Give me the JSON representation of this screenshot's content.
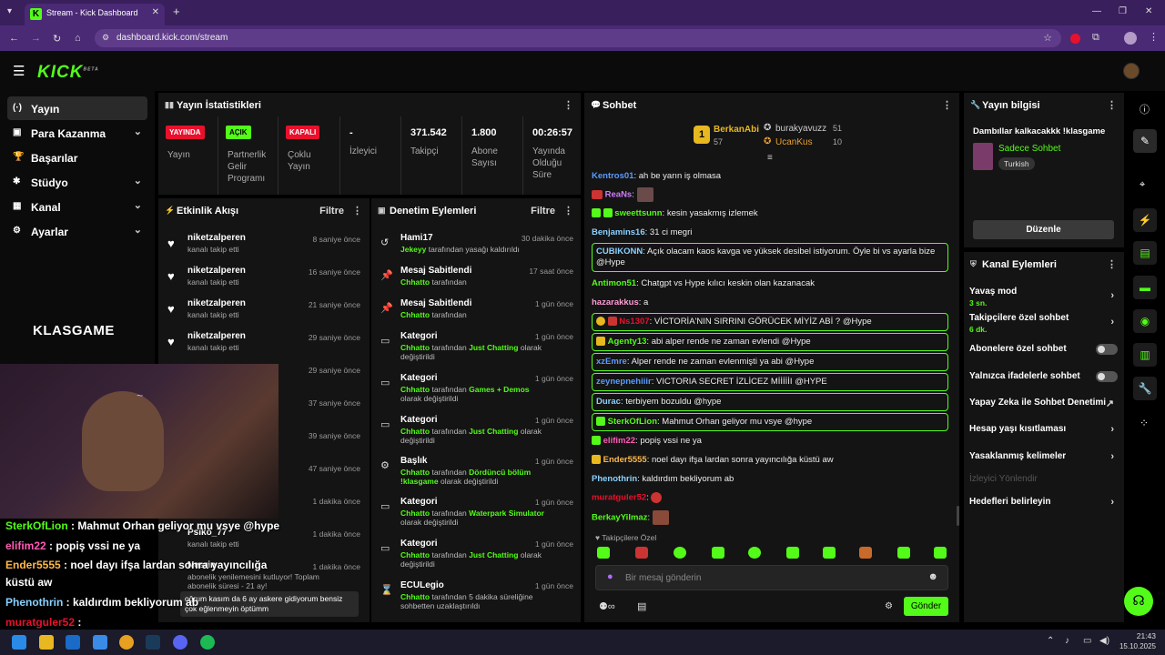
{
  "browser": {
    "tab_title": "Stream - Kick Dashboard",
    "url": "dashboard.kick.com/stream",
    "favicon_letter": "K"
  },
  "app": {
    "logo": "KICK",
    "logo_sup": "BETA"
  },
  "sidebar": {
    "items": [
      {
        "label": "Yayın",
        "icon": "broadcast-icon"
      },
      {
        "label": "Para Kazanma",
        "icon": "money-icon"
      },
      {
        "label": "Başarılar",
        "icon": "trophy-icon"
      },
      {
        "label": "Stüdyo",
        "icon": "studio-icon"
      },
      {
        "label": "Kanal",
        "icon": "channel-icon"
      },
      {
        "label": "Ayarlar",
        "icon": "gear-icon"
      }
    ],
    "brand": "KLASGAME"
  },
  "stats": {
    "title": "Yayın İstatistikleri",
    "items": [
      {
        "value": "YAYINDA",
        "label": "Yayın",
        "color": "#e8112d"
      },
      {
        "value": "AÇIK",
        "label": "Partnerlik Gelir Programı",
        "color": "#53fc18"
      },
      {
        "value": "KAPALI",
        "label": "Çoklu Yayın",
        "color": "#e8112d"
      },
      {
        "value": "-",
        "label": "İzleyici"
      },
      {
        "value": "371.542",
        "label": "Takipçi"
      },
      {
        "value": "1.800",
        "label": "Abone Sayısı"
      },
      {
        "value": "00:26:57",
        "label": "Yayında Olduğu Süre"
      }
    ]
  },
  "activity": {
    "title": "Etkinlik Akışı",
    "filter": "Filtre",
    "items": [
      {
        "name": "niketzalperen",
        "sub": "kanalı takip etti",
        "time": "8 saniye önce"
      },
      {
        "name": "niketzalperen",
        "sub": "kanalı takip etti",
        "time": "16 saniye önce"
      },
      {
        "name": "niketzalperen",
        "sub": "kanalı takip etti",
        "time": "21 saniye önce"
      },
      {
        "name": "niketzalperen",
        "sub": "kanalı takip etti",
        "time": "29 saniye önce"
      },
      {
        "time": "29 saniye önce"
      },
      {
        "time": "37 saniye önce"
      },
      {
        "time": "39 saniye önce"
      },
      {
        "time": "47 saniye önce"
      },
      {
        "time": "1 dakika önce"
      },
      {
        "name": "Psiko_77",
        "sub": "kanalı takip etti",
        "time": "1 dakika önce"
      },
      {
        "name": "Nesrin",
        "sub": "abonelik yenilemesini kutluyor! Toplam abonelik süresi - 21 ay!",
        "time": "1 dakika önce"
      }
    ],
    "bubble": "oğrum kasım da 6 ay askere gidiyorum bensiz çok eğlenmeyin öptümm"
  },
  "moderation": {
    "title": "Denetim Eylemleri",
    "filter": "Filtre",
    "items": [
      {
        "title": "Hami17",
        "by": "Jekeyy",
        "rest": "tarafından yasağı kaldırıldı",
        "time": "30 dakika önce",
        "icon": "undo-icon"
      },
      {
        "title": "Mesaj Sabitlendi",
        "by": "Chhatto",
        "rest": "tarafından",
        "time": "17 saat önce",
        "icon": "pin-icon"
      },
      {
        "title": "Mesaj Sabitlendi",
        "by": "Chhatto",
        "rest": "tarafından",
        "time": "1 gün önce",
        "icon": "pin-icon"
      },
      {
        "title": "Kategori",
        "by": "Chhatto",
        "rest": "tarafından",
        "cat": "Just Chatting",
        "rest2": "olarak değiştirildi",
        "time": "1 gün önce",
        "icon": "category-icon"
      },
      {
        "title": "Kategori",
        "by": "Chhatto",
        "rest": "tarafından",
        "cat": "Games + Demos",
        "rest2": "olarak değiştirildi",
        "time": "1 gün önce",
        "icon": "category-icon"
      },
      {
        "title": "Kategori",
        "by": "Chhatto",
        "rest": "tarafından",
        "cat": "Just Chatting",
        "rest2": "olarak değiştirildi",
        "time": "1 gün önce",
        "icon": "category-icon"
      },
      {
        "title": "Başlık",
        "by": "Chhatto",
        "rest": "tarafından",
        "cat": "Dördüncü bölüm !klasgame",
        "rest2": "olarak değiştirildi",
        "time": "1 gün önce",
        "icon": "title-icon"
      },
      {
        "title": "Kategori",
        "by": "Chhatto",
        "rest": "tarafından",
        "cat": "Waterpark Simulator",
        "rest2": "olarak değiştirildi",
        "time": "1 gün önce",
        "icon": "category-icon"
      },
      {
        "title": "Kategori",
        "by": "Chhatto",
        "rest": "tarafından",
        "cat": "Just Chatting",
        "rest2": "olarak değiştirildi",
        "time": "1 gün önce",
        "icon": "category-icon"
      },
      {
        "title": "ECULegio",
        "by": "Chhatto",
        "rest": "tarafından 5 dakika süreliğine sohbetten uzaklaştırıldı",
        "time": "1 gün önce",
        "icon": "hourglass-icon"
      }
    ]
  },
  "chat": {
    "title": "Sohbet",
    "leaders": [
      {
        "name": "BerkanAbi",
        "count": "57",
        "rank": "1"
      },
      {
        "name": "burakyavuzz",
        "count": "51"
      },
      {
        "name": "UcanKus",
        "count": "10"
      }
    ],
    "messages": [
      {
        "user": "Kentros01",
        "color": "#5b9bff",
        "text": "ah be yarın iş olmasa"
      },
      {
        "user": "ReaNs",
        "color": "#d17bff",
        "text": ""
      },
      {
        "user": "sweettsunn",
        "color": "#53fc18",
        "text": "kesin yasakmış izlemek"
      },
      {
        "user": "Benjamins16",
        "color": "#8ad1ff",
        "text": "31 ci megri"
      },
      {
        "user": "CUBIKONN",
        "color": "#8ad1ff",
        "text": "Açık olacam kaos kavga ve yüksek desibel istiyorum. Öyle bi vs ayarla bize @Hype",
        "hl": true
      },
      {
        "user": "Antimon51",
        "color": "#53fc18",
        "text": "Chatgpt vs Hype kılıcı keskin olan kazanacak"
      },
      {
        "user": "hazarakkus",
        "color": "#ff9bd5",
        "text": "a"
      },
      {
        "user": "Ns1307",
        "color": "#e8112d",
        "text": "VİCTORİA'NIN SIRRINI GÖRÜCEK MİYİZ ABİ ? @Hype",
        "hl": true
      },
      {
        "user": "Agenty13",
        "color": "#53fc18",
        "text": "abi alper rende ne zaman evlendi @Hype",
        "hl": true
      },
      {
        "user": "xzEmre",
        "color": "#5b9bff",
        "text": "Alper rende ne zaman evlenmişti ya abi @Hype",
        "hl": true
      },
      {
        "user": "zeynepnehiiir",
        "color": "#5b9bff",
        "text": "VICTORIA SECRET İZLİCEZ MİİİİİI @HYPE",
        "hl": true
      },
      {
        "user": "Durac",
        "color": "#8ad1ff",
        "text": "terbiyem bozuldu @hype",
        "hl": true
      },
      {
        "user": "SterkOfLion",
        "color": "#53fc18",
        "text": "Mahmut Orhan geliyor mu vsye @hype",
        "hl": true
      },
      {
        "user": "elifim22",
        "color": "#ff5ab4",
        "text": "popiş vssi ne ya"
      },
      {
        "user": "Ender5555",
        "color": "#ffb84a",
        "text": "noel dayı ifşa lardan sonra yayıncılığa küstü aw"
      },
      {
        "user": "Phenothrin",
        "color": "#8ad1ff",
        "text": "kaldırdım bekliyorum ab"
      },
      {
        "user": "muratguler52",
        "color": "#e8112d",
        "text": ""
      },
      {
        "user": "BerkayYilmaz",
        "color": "#53fc18",
        "text": ""
      }
    ],
    "followers_only": "Takipçilere Özel",
    "input_placeholder": "Bir mesaj gönderin",
    "send": "Gönder"
  },
  "stream_info": {
    "title": "Yayın bilgisi",
    "stream_title": "Dambıllar kalkacakkk !klasgame",
    "category": "Sadece Sohbet",
    "tag": "Turkish",
    "edit": "Düzenle"
  },
  "channel_actions": {
    "title": "Kanal Eylemleri",
    "items": [
      {
        "label": "Yavaş mod",
        "sub": "3 sn.",
        "type": "chevron"
      },
      {
        "label": "Takipçilere özel sohbet",
        "sub": "6 dk.",
        "type": "chevron"
      },
      {
        "label": "Abonelere özel sohbet",
        "type": "toggle"
      },
      {
        "label": "Yalnızca ifadelerle sohbet",
        "type": "toggle"
      },
      {
        "label": "Yapay Zeka ile Sohbet Denetimi",
        "type": "external"
      },
      {
        "label": "Hesap yaşı kısıtlaması",
        "type": "chevron"
      },
      {
        "label": "Yasaklanmış kelimeler",
        "type": "chevron"
      },
      {
        "label": "İzleyici Yönlendir",
        "type": "disabled"
      },
      {
        "label": "Hedefleri belirleyin",
        "type": "chevron"
      }
    ]
  },
  "overlay_chat": [
    {
      "user": "SterkOfLion",
      "color": "#53fc18",
      "text": " : Mahmut Orhan geliyor mu vsye @hype"
    },
    {
      "user": "elifim22",
      "color": "#ff5ab4",
      "text": " : popiş vssi ne ya"
    },
    {
      "user": "Ender5555",
      "color": "#ffb84a",
      "text": " : noel dayı ifşa lardan sonra yayıncılığa"
    },
    {
      "user": "",
      "color": "#fff",
      "text": "küstü aw"
    },
    {
      "user": "Phenothrin",
      "color": "#8ad1ff",
      "text": " : kaldırdım bekliyorum ab"
    },
    {
      "user": "muratguler52",
      "color": "#e8112d",
      "text": " :"
    }
  ],
  "taskbar": {
    "time": "21:43",
    "date": "15.10.2025"
  },
  "colors": {
    "accent": "#53fc18",
    "live": "#e8112d",
    "panel": "#141414"
  }
}
